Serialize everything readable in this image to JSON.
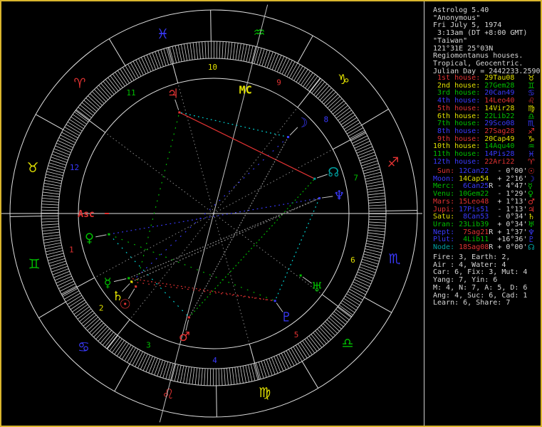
{
  "app": {
    "border_color": "#d9b52e",
    "background": "#000000"
  },
  "palette": {
    "red": "#e13232",
    "yellow": "#e0e000",
    "green": "#00c000",
    "blue": "#3a3aff",
    "cyan": "#00d8d8",
    "dkcyan": "#00a0a0",
    "white": "#d8d8d8",
    "gray": "#8a8a8a",
    "ltgray": "#c0c0c0",
    "line": "#e0e0e0",
    "tick": "#cfcfcf",
    "pointer": "#c8c8c8"
  },
  "panel": {
    "header": [
      "Astrolog 5.40",
      "\"Anonymous\"",
      "Fri July 5, 1974",
      " 3:13am (DT +8:00 GMT)",
      "\"Taiwan\"",
      "121°31E 25°03N",
      "Regiomontanus houses.",
      "Tropical, Geocentric.",
      "Julian Day = 2442233.2590"
    ],
    "houses": [
      {
        "ord": " 1st",
        "cusp": "29Tau08",
        "sign": 1
      },
      {
        "ord": " 2nd",
        "cusp": "27Gem28",
        "sign": 2
      },
      {
        "ord": " 3rd",
        "cusp": "20Can49",
        "sign": 3
      },
      {
        "ord": " 4th",
        "cusp": "14Leo40",
        "sign": 4
      },
      {
        "ord": " 5th",
        "cusp": "14Vir28",
        "sign": 5
      },
      {
        "ord": " 6th",
        "cusp": "22Lib22",
        "sign": 6
      },
      {
        "ord": " 7th",
        "cusp": "29Sco08",
        "sign": 7
      },
      {
        "ord": " 8th",
        "cusp": "27Sag28",
        "sign": 8
      },
      {
        "ord": " 9th",
        "cusp": "20Cap49",
        "sign": 9
      },
      {
        "ord": "10th",
        "cusp": "14Aqu40",
        "sign": 10
      },
      {
        "ord": "11th",
        "cusp": "14Pis28",
        "sign": 11
      },
      {
        "ord": "12th",
        "cusp": "22Ari22",
        "sign": 0
      }
    ],
    "house_word": "house: ",
    "stats": [
      "Fire: 3, Earth: 2,",
      "Air : 4, Water: 4",
      "Car: 6, Fix: 3, Mut: 4",
      "Yang: 7, Yin: 6",
      "M: 4, N: 7, A: 5, D: 6",
      "Ang: 4, Suc: 6, Cad: 1",
      "Learn: 6, Share: 7"
    ]
  },
  "planets": [
    {
      "name": " Sun",
      "value": "12Can22",
      "retro": false,
      "delta": "- 0°00'",
      "sign": 3,
      "glyph": "☉",
      "color": "red",
      "lon": 102.367,
      "goff": 2.5
    },
    {
      "name": "Moon",
      "value": "14Cap54",
      "retro": false,
      "delta": "+ 2°16'",
      "sign": 9,
      "glyph": "☽",
      "color": "blue",
      "lon": 284.9,
      "goff": 0
    },
    {
      "name": "Merc",
      "value": " 6Can25",
      "retro": true,
      "delta": "- 4°47'",
      "sign": 3,
      "glyph": "☿",
      "color": "green",
      "lon": 96.417,
      "goff": -4
    },
    {
      "name": "Venu",
      "value": "10Gem22",
      "retro": false,
      "delta": "- 1°29'",
      "sign": 2,
      "glyph": "♀",
      "color": "green",
      "lon": 70.367,
      "goff": 0
    },
    {
      "name": "Mars",
      "value": "15Leo48",
      "retro": false,
      "delta": "+ 1°13'",
      "sign": 4,
      "glyph": "♂",
      "color": "red",
      "lon": 135.8,
      "goff": 0
    },
    {
      "name": "Jupi",
      "value": "17Pis51",
      "retro": false,
      "delta": "- 1°13'",
      "sign": 11,
      "glyph": "♃",
      "color": "red",
      "lon": 347.85,
      "goff": 0
    },
    {
      "name": "Satu",
      "value": " 8Can53",
      "retro": false,
      "delta": "- 0°34'",
      "sign": 3,
      "glyph": "♄",
      "color": "yellow",
      "lon": 98.883,
      "goff": 1
    },
    {
      "name": "Uran",
      "value": "23Lib39",
      "retro": false,
      "delta": "+ 0°34'",
      "sign": 6,
      "glyph": "♅",
      "color": "green",
      "lon": 203.65,
      "goff": 0
    },
    {
      "name": "Nept",
      "value": " 7Sag21",
      "retro": true,
      "delta": "+ 1°37'",
      "sign": 8,
      "glyph": "♆",
      "color": "blue",
      "lon": 247.35,
      "goff": 0
    },
    {
      "name": "Plut",
      "value": " 4Lib11",
      "retro": false,
      "delta": "+16°36'",
      "sign": 6,
      "glyph": "♇",
      "color": "blue",
      "lon": 184.183,
      "goff": 0
    },
    {
      "name": "Node",
      "value": "18Sag08",
      "retro": true,
      "delta": "+ 0°00'",
      "sign": 8,
      "glyph": "☊",
      "color": "dkcyan",
      "lon": 258.133,
      "goff": 0
    }
  ],
  "signs": [
    {
      "abbr": "Ari",
      "glyph": "♈"
    },
    {
      "abbr": "Tau",
      "glyph": "♉"
    },
    {
      "abbr": "Gem",
      "glyph": "♊"
    },
    {
      "abbr": "Can",
      "glyph": "♋"
    },
    {
      "abbr": "Leo",
      "glyph": "♌"
    },
    {
      "abbr": "Vir",
      "glyph": "♍"
    },
    {
      "abbr": "Lib",
      "glyph": "♎"
    },
    {
      "abbr": "Sco",
      "glyph": "♏"
    },
    {
      "abbr": "Sag",
      "glyph": "♐"
    },
    {
      "abbr": "Cap",
      "glyph": "♑"
    },
    {
      "abbr": "Aqu",
      "glyph": "♒"
    },
    {
      "abbr": "Pis",
      "glyph": "♓"
    }
  ],
  "wheel": {
    "asc_lon": 59.133,
    "cusps": [
      59.133,
      87.467,
      110.817,
      134.667,
      164.467,
      202.367,
      239.133,
      267.467,
      290.817,
      314.667,
      344.467,
      22.367
    ],
    "labels": {
      "asc": "Asc",
      "mc": "MC"
    },
    "house_number_color_cycle": [
      "red",
      "yellow",
      "green",
      "blue"
    ],
    "sign_color_cycle": [
      "red",
      "yellow",
      "green",
      "blue"
    ],
    "aspect_colors": {
      "conjunction": "yellow",
      "opposition": "blue",
      "square": "red",
      "trine": "green",
      "sextile": "cyan",
      "quincunx": "gray"
    },
    "aspects": [
      {
        "p1": 0,
        "p2": 2,
        "type": "conjunction",
        "orb": 5.95
      },
      {
        "p1": 0,
        "p2": 6,
        "type": "conjunction",
        "orb": 3.48
      },
      {
        "p1": 2,
        "p2": 6,
        "type": "conjunction",
        "orb": 2.47
      },
      {
        "p1": 1,
        "p2": 6,
        "type": "opposition",
        "orb": 6.02
      },
      {
        "p1": 3,
        "p2": 8,
        "type": "opposition",
        "orb": 3.02
      },
      {
        "p1": 5,
        "p2": 10,
        "type": "square",
        "orb": 0.28
      },
      {
        "p1": 2,
        "p2": 9,
        "type": "square",
        "orb": 2.23
      },
      {
        "p1": 6,
        "p2": 9,
        "type": "square",
        "orb": 4.7
      },
      {
        "p1": 0,
        "p2": 5,
        "type": "trine",
        "orb": 5.48
      },
      {
        "p1": 3,
        "p2": 9,
        "type": "trine",
        "orb": 6.18
      },
      {
        "p1": 4,
        "p2": 10,
        "type": "trine",
        "orb": 2.33
      },
      {
        "p1": 1,
        "p2": 5,
        "type": "sextile",
        "orb": 2.95
      },
      {
        "p1": 8,
        "p2": 9,
        "type": "sextile",
        "orb": 3.17
      },
      {
        "p1": 3,
        "p2": 4,
        "type": "sextile",
        "orb": 5.43
      },
      {
        "p1": 1,
        "p2": 4,
        "type": "quincunx",
        "orb": 0.9
      },
      {
        "p1": 2,
        "p2": 8,
        "type": "quincunx",
        "orb": 0.93
      },
      {
        "p1": 6,
        "p2": 8,
        "type": "quincunx",
        "orb": 1.53
      }
    ]
  }
}
